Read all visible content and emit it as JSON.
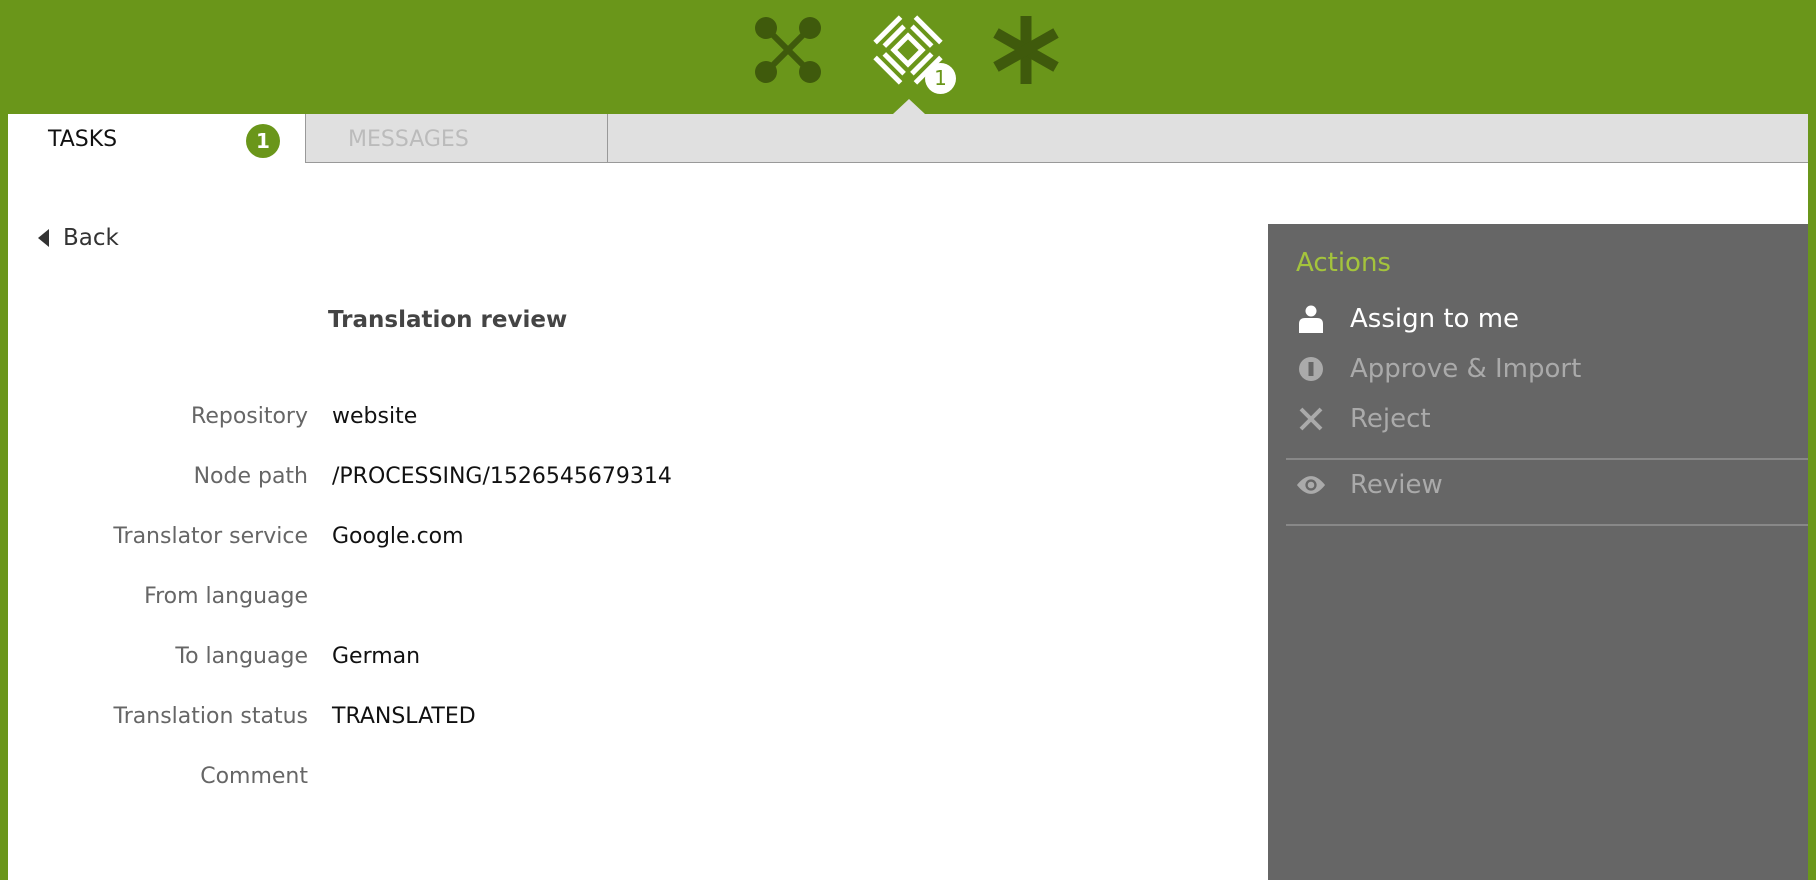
{
  "topbar": {
    "icons": [
      "nodes-icon",
      "workflow-icon",
      "asterisk-icon"
    ],
    "notification_count": "1"
  },
  "tabs": [
    {
      "label": "TASKS",
      "badge": "1",
      "active": true
    },
    {
      "label": "MESSAGES",
      "active": false
    }
  ],
  "back_label": "Back",
  "title": "Translation review",
  "fields": [
    {
      "label": "Repository",
      "value": "website"
    },
    {
      "label": "Node path",
      "value": "/PROCESSING/1526545679314"
    },
    {
      "label": "Translator service",
      "value": "Google.com"
    },
    {
      "label": "From language",
      "value": ""
    },
    {
      "label": "To language",
      "value": "German"
    },
    {
      "label": "Translation status",
      "value": "TRANSLATED"
    },
    {
      "label": "Comment",
      "value": ""
    }
  ],
  "actions": {
    "heading": "Actions",
    "items": [
      {
        "label": "Assign to me",
        "icon": "user-icon",
        "enabled": true
      },
      {
        "label": "Approve & Import",
        "icon": "info-icon",
        "enabled": false
      },
      {
        "label": "Reject",
        "icon": "close-icon",
        "enabled": false
      },
      {
        "label": "Review",
        "icon": "eye-icon",
        "enabled": false
      }
    ]
  },
  "colors": {
    "brand": "#6a961a",
    "accent": "#a4c43c",
    "panel": "#666666"
  }
}
